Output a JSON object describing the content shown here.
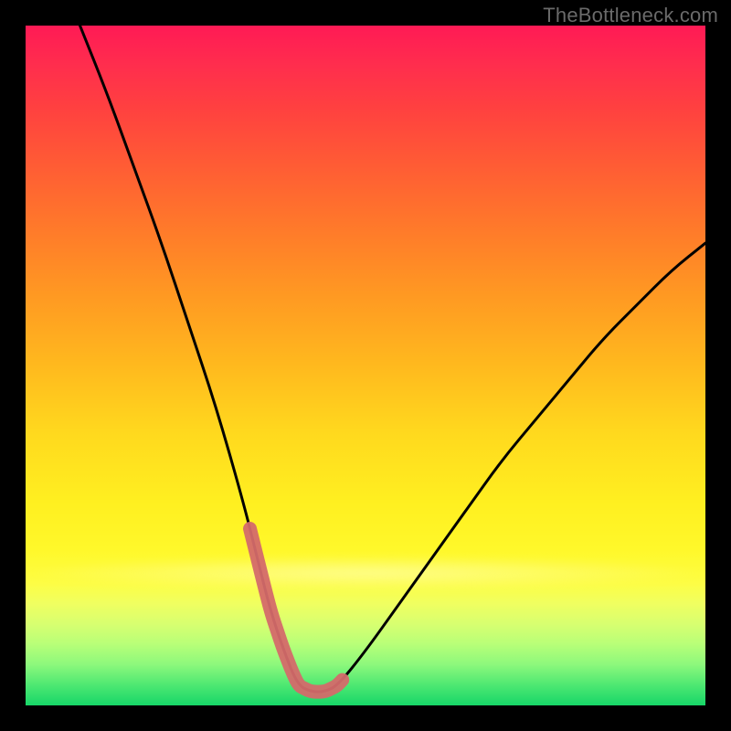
{
  "watermark": "TheBottleneck.com",
  "chart_data": {
    "type": "line",
    "title": "",
    "xlabel": "",
    "ylabel": "",
    "xlim": [
      0,
      100
    ],
    "ylim": [
      0,
      100
    ],
    "series": [
      {
        "name": "bottleneck-curve",
        "x": [
          8,
          12,
          16,
          20,
          24,
          28,
          32,
          34,
          36,
          38,
          40,
          42,
          44,
          46,
          50,
          55,
          60,
          65,
          70,
          75,
          80,
          85,
          90,
          95,
          100
        ],
        "values": [
          100,
          90,
          79,
          68,
          56,
          44,
          30,
          22,
          14,
          8,
          3,
          2,
          2,
          3,
          8,
          15,
          22,
          29,
          36,
          42,
          48,
          54,
          59,
          64,
          68
        ]
      }
    ],
    "highlight": {
      "name": "optimal-range",
      "x_range": [
        33,
        47
      ],
      "color": "#d46a6a"
    }
  }
}
